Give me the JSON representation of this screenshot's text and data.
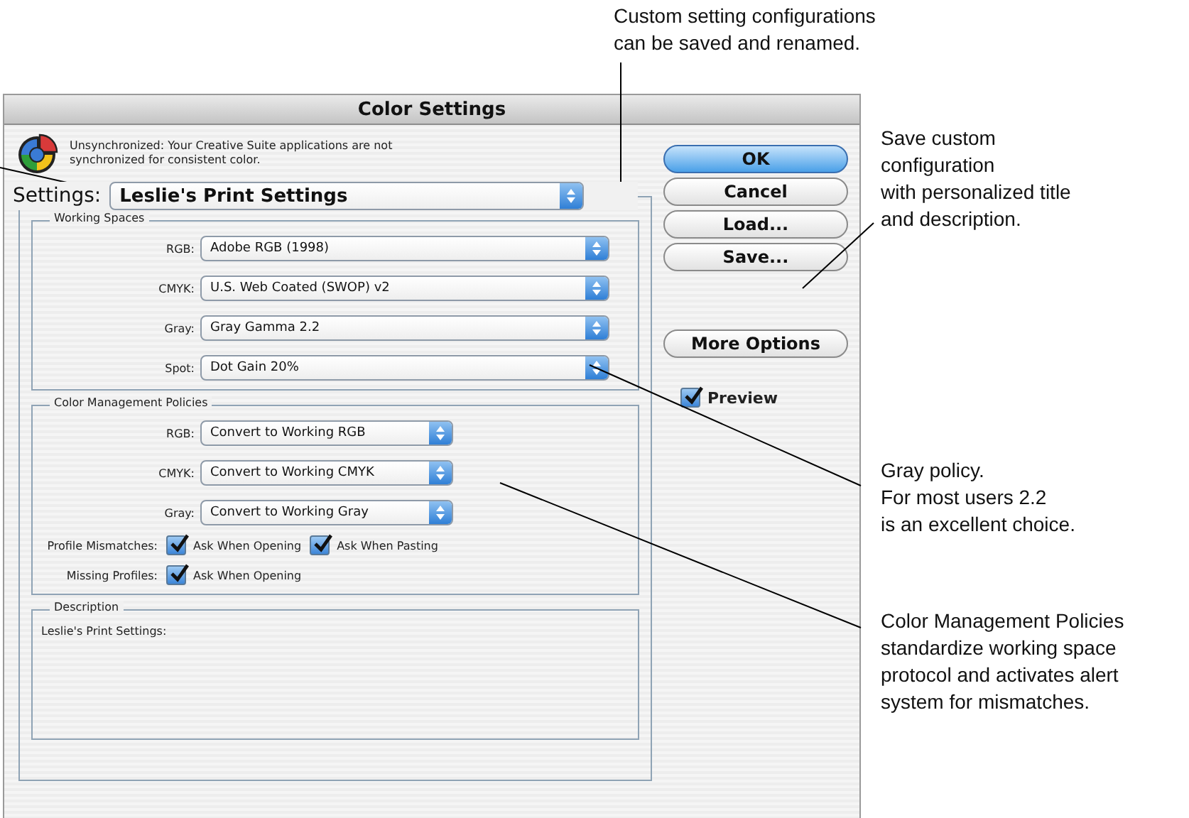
{
  "annotations": [
    {
      "lines": [
        "Custom setting configurations",
        "can be saved and renamed."
      ]
    },
    {
      "lines": [
        "Save custom",
        "configuration",
        "with personalized title",
        "and description."
      ]
    },
    {
      "lines": [
        "Gray policy.",
        "For most users 2.2",
        "is an excellent choice."
      ]
    },
    {
      "lines": [
        "Color Management Policies",
        "standardize working space",
        "protocol and activates alert",
        "system for mismatches."
      ]
    }
  ],
  "dialog": {
    "title": "Color Settings",
    "message": [
      "Unsynchronized: Your Creative Suite applications are not",
      "synchronized for consistent color."
    ],
    "settings": {
      "label": "Settings:",
      "value": "Leslie's Print Settings"
    },
    "working_spaces": {
      "title": "Working Spaces",
      "rows": [
        {
          "label": "RGB:",
          "value": "Adobe RGB (1998)"
        },
        {
          "label": "CMYK:",
          "value": "U.S. Web Coated (SWOP) v2"
        },
        {
          "label": "Gray:",
          "value": "Gray Gamma 2.2"
        },
        {
          "label": "Spot:",
          "value": "Dot Gain 20%"
        }
      ]
    },
    "policies": {
      "title": "Color Management Policies",
      "rows": [
        {
          "label": "RGB:",
          "value": "Convert to Working RGB"
        },
        {
          "label": "CMYK:",
          "value": "Convert to Working CMYK"
        },
        {
          "label": "Gray:",
          "value": "Convert to Working Gray"
        }
      ],
      "checks": [
        {
          "label": "Profile Mismatches:",
          "options": [
            {
              "label": "Ask When Opening",
              "checked": true
            },
            {
              "label": "Ask When Pasting",
              "checked": true
            }
          ]
        },
        {
          "label": "Missing Profiles:",
          "options": [
            {
              "label": "Ask When Opening",
              "checked": true
            }
          ]
        }
      ]
    },
    "description": {
      "title": "Description",
      "text": "Leslie's Print Settings:"
    },
    "buttons": [
      {
        "label": "OK",
        "default": true
      },
      {
        "label": "Cancel",
        "default": false
      },
      {
        "label": "Load...",
        "default": false
      },
      {
        "label": "Save...",
        "default": false
      },
      {
        "label": "More Options",
        "default": false
      }
    ],
    "preview": {
      "label": "Preview",
      "checked": true
    }
  }
}
